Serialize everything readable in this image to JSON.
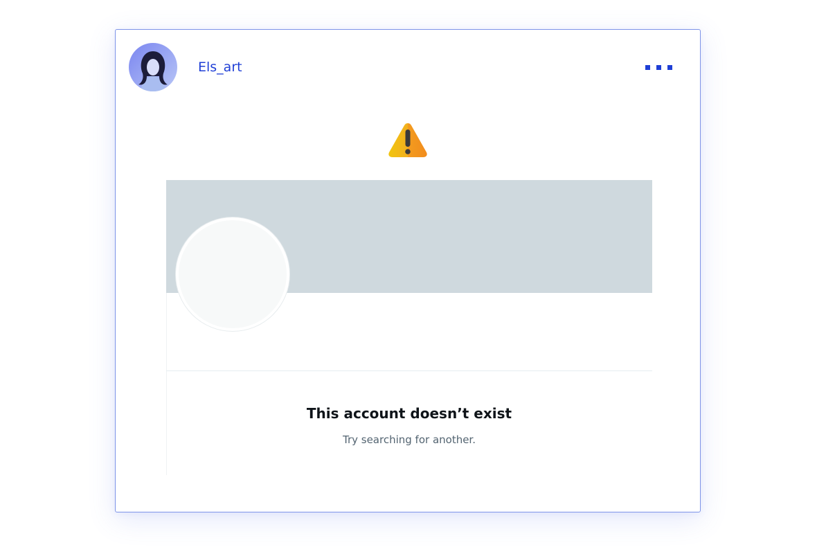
{
  "post": {
    "username": "Els_art",
    "avatar_icon": "user-avatar-photo",
    "more_icon": "more-dots-icon",
    "accent_color": "#1f3fd6"
  },
  "warning": {
    "icon": "warning-triangle-icon",
    "color": "#f2b01e"
  },
  "embed": {
    "banner_color": "#cfd9de",
    "title": "This account doesn’t exist",
    "subtitle": "Try searching for another."
  }
}
